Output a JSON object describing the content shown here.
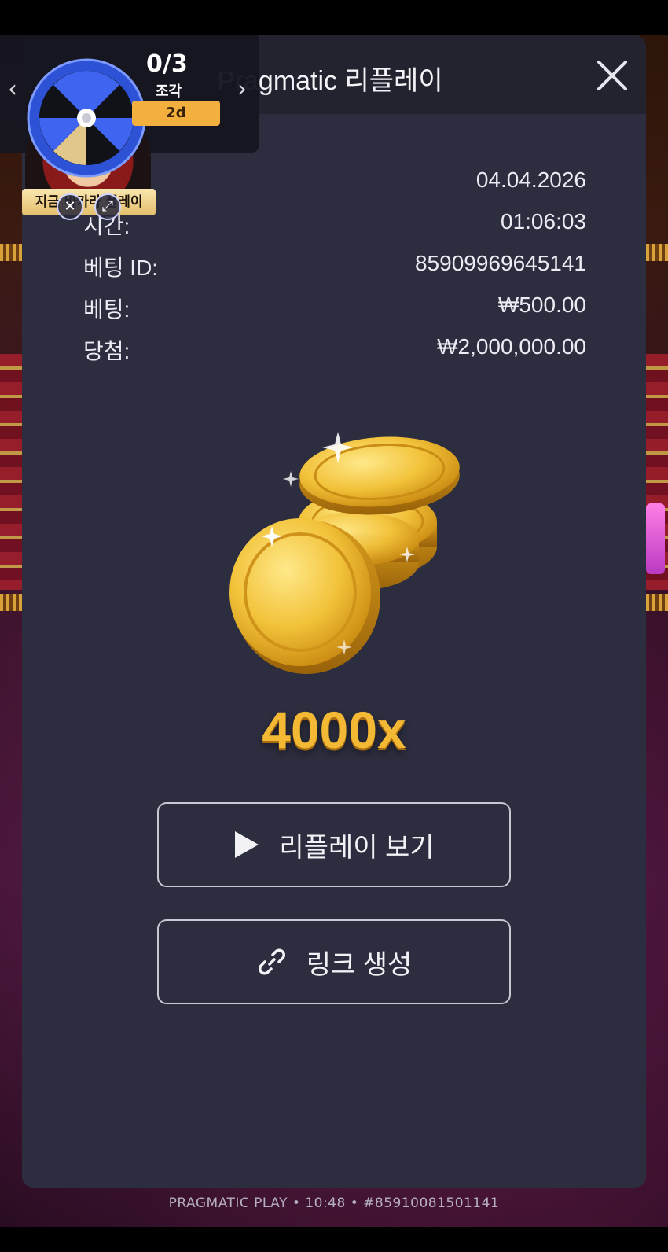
{
  "modal": {
    "title": "Pragmatic 리플레이",
    "close_icon": "close-icon",
    "info": [
      {
        "label": "",
        "value": "04.04.2026"
      },
      {
        "label": "시간:",
        "value": "01:06:03"
      },
      {
        "label": "베팅 ID:",
        "value": "85909969645141"
      },
      {
        "label": "베팅:",
        "value": "₩500.00"
      },
      {
        "label": "당첨:",
        "value": "₩2,000,000.00"
      }
    ],
    "illustration": "gold-coins-icon",
    "multiplier": "4000x",
    "buttons": {
      "replay": {
        "label": "리플레이 보기",
        "icon": "play-icon"
      },
      "link": {
        "label": "링크 생성",
        "icon": "link-icon"
      }
    }
  },
  "promo": {
    "count": "0/3",
    "unit": "조각",
    "days": "2d",
    "banner": "지금 바카라 플레이",
    "prev_icon": "chevron-left-icon",
    "next_icon": "chevron-right-icon",
    "wheel_icon": "prize-wheel-icon"
  },
  "footer": {
    "text": "PRAGMATIC PLAY • 10:48 • #85910081501141"
  },
  "colors": {
    "modal_bg": "#2c2d3e",
    "header_bg": "#23232f",
    "multiplier": "#f3b934",
    "promo_badge": "#f4b03e"
  }
}
